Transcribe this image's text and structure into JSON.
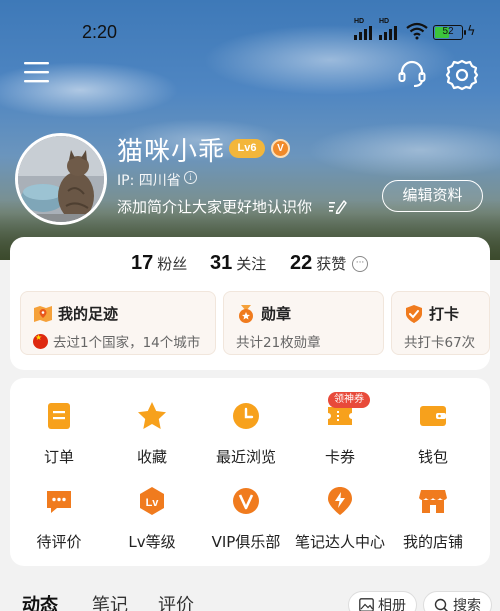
{
  "status_bar": {
    "time": "2:20",
    "signal_label": "HD",
    "battery": "52"
  },
  "header": {
    "menu_icon": "menu-icon",
    "support_icon": "headset-icon",
    "settings_icon": "gear-icon"
  },
  "profile": {
    "username": "猫咪小乖",
    "level": "Lv6",
    "v_badge": "V",
    "ip": "IP: 四川省",
    "bio": "添加简介让大家更好地认识你",
    "edit_button": "编辑资料"
  },
  "stats": [
    {
      "num": "17",
      "label": "粉丝"
    },
    {
      "num": "31",
      "label": "关注"
    },
    {
      "num": "22",
      "label": "获赞"
    }
  ],
  "features": [
    {
      "title": "我的足迹",
      "subtitle": "去过1个国家，14个城市",
      "icon": "map-pin-icon"
    },
    {
      "title": "勋章",
      "subtitle": "共计21枚勋章",
      "icon": "medal-icon"
    },
    {
      "title": "打卡",
      "subtitle": "共打卡67次",
      "icon": "checkin-icon"
    }
  ],
  "services": [
    {
      "label": "订单",
      "icon": "order-icon"
    },
    {
      "label": "收藏",
      "icon": "star-icon"
    },
    {
      "label": "最近浏览",
      "icon": "clock-icon"
    },
    {
      "label": "卡券",
      "icon": "ticket-icon"
    },
    {
      "label": "钱包",
      "icon": "wallet-icon"
    },
    {
      "label": "待评价",
      "icon": "review-icon"
    },
    {
      "label": "Lv等级",
      "icon": "level-icon"
    },
    {
      "label": "VIP俱乐部",
      "icon": "vip-icon"
    },
    {
      "label": "笔记达人中心",
      "icon": "lightning-icon"
    },
    {
      "label": "我的店铺",
      "icon": "shop-icon"
    }
  ],
  "coupon_tag": "领神券",
  "tabs": [
    "动态",
    "笔记",
    "评价"
  ],
  "actions": {
    "album": "相册",
    "search": "搜索"
  },
  "colors": {
    "accent_orange": "#f28a1f",
    "badge_yellow": "#f3b63b",
    "tag_red": "#e84a3a"
  }
}
